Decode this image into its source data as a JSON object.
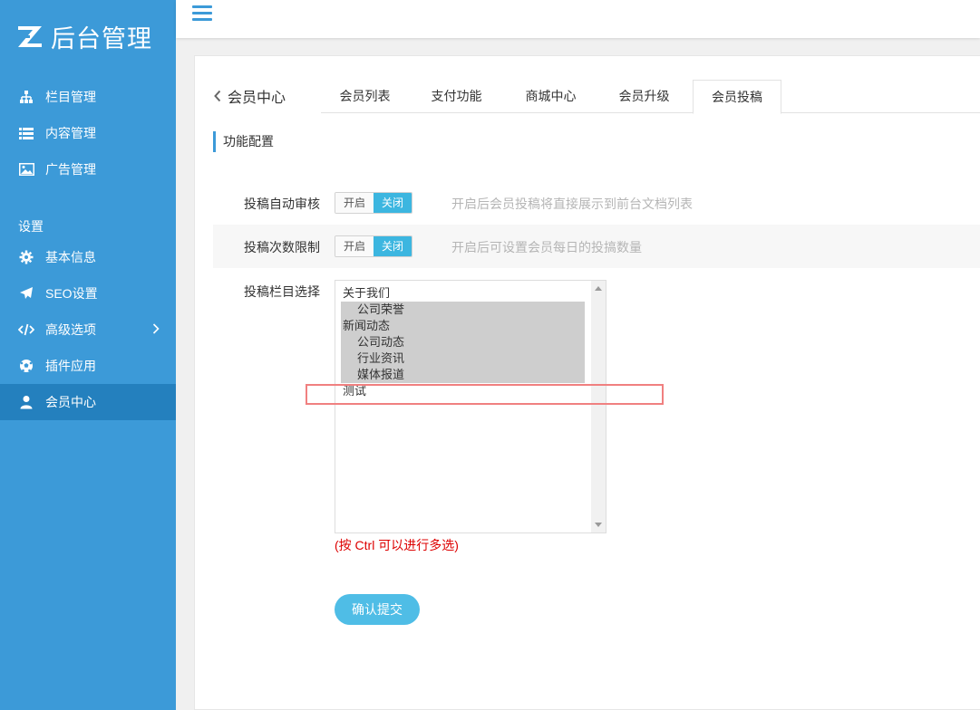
{
  "brand": {
    "logo_text": "后台管理"
  },
  "sidebar": {
    "items": [
      {
        "label": "栏目管理",
        "icon": "sitemap-icon"
      },
      {
        "label": "内容管理",
        "icon": "list-icon"
      },
      {
        "label": "广告管理",
        "icon": "image-icon"
      }
    ],
    "group_label": "设置",
    "settings_items": [
      {
        "label": "基本信息",
        "icon": "gear-icon"
      },
      {
        "label": "SEO设置",
        "icon": "paper-plane-icon"
      },
      {
        "label": "高级选项",
        "icon": "code-icon"
      },
      {
        "label": "插件应用",
        "icon": "soccer-ball-icon"
      },
      {
        "label": "会员中心",
        "icon": "user-icon",
        "active": true
      }
    ]
  },
  "breadcrumb": {
    "label": "会员中心"
  },
  "tabs": [
    {
      "label": "会员列表"
    },
    {
      "label": "支付功能"
    },
    {
      "label": "商城中心"
    },
    {
      "label": "会员升级"
    },
    {
      "label": "会员投稿",
      "active": true
    }
  ],
  "section": {
    "title": "功能配置"
  },
  "form": {
    "auto_review": {
      "label": "投稿自动审核",
      "on_label": "开启",
      "off_label": "关闭",
      "selected": "关闭",
      "hint": "开启后会员投稿将直接展示到前台文档列表"
    },
    "count_limit": {
      "label": "投稿次数限制",
      "on_label": "开启",
      "off_label": "关闭",
      "selected": "关闭",
      "hint": "开启后可设置会员每日的投搞数量"
    },
    "column_select": {
      "label": "投稿栏目选择",
      "options": [
        {
          "label": "关于我们",
          "selected": false,
          "indent": false
        },
        {
          "label": "公司荣誉",
          "selected": true,
          "indent": true
        },
        {
          "label": "新闻动态",
          "selected": true,
          "indent": false
        },
        {
          "label": "公司动态",
          "selected": true,
          "indent": true
        },
        {
          "label": "行业资讯",
          "selected": true,
          "indent": true
        },
        {
          "label": "媒体报道",
          "selected": true,
          "indent": true
        },
        {
          "label": "测试",
          "selected": false,
          "indent": false
        }
      ],
      "note": "(按 Ctrl 可以进行多选)"
    },
    "submit_label": "确认提交"
  },
  "colors": {
    "sidebar_bg": "#3c9ad8",
    "sidebar_active": "#2480be",
    "accent": "#3cb6e0",
    "submit_bg": "#4fbde6",
    "note_red": "#d00000",
    "highlight_box": "#f08080"
  }
}
